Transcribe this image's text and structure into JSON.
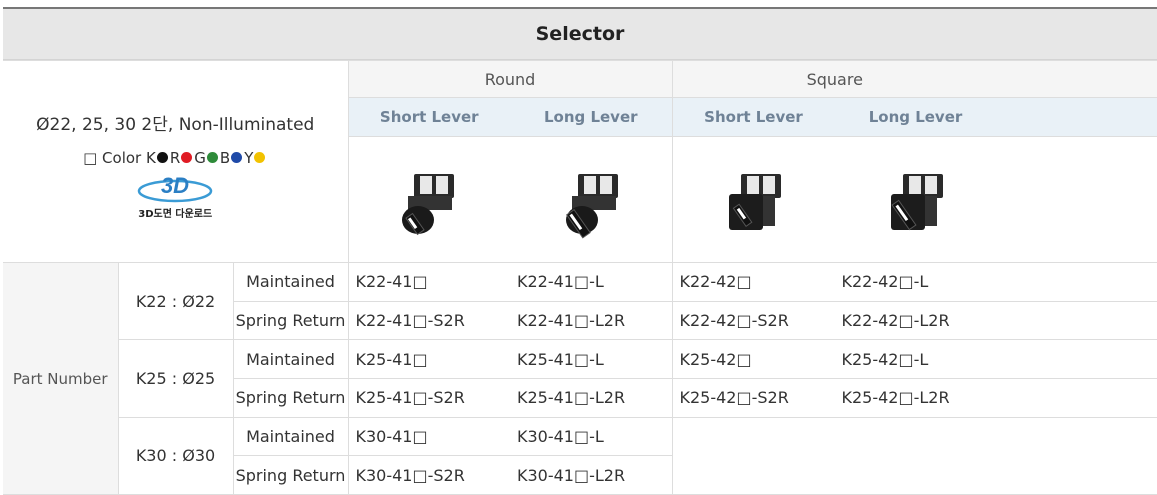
{
  "title": "Selector",
  "info": {
    "spec": "Ø22, 25, 30 2단, Non-Illuminated",
    "color_prefix": "□ Color",
    "colors": [
      {
        "letter": "K",
        "hex": "#111111"
      },
      {
        "letter": "R",
        "hex": "#e01b24"
      },
      {
        "letter": "G",
        "hex": "#2e8b3a"
      },
      {
        "letter": "B",
        "hex": "#1f4aa8"
      },
      {
        "letter": "Y",
        "hex": "#f2c200"
      }
    ],
    "logo_text": "3D",
    "download_label": "3D도면 다운로드"
  },
  "groups": [
    "Round",
    "Square"
  ],
  "sub_headers": [
    "Short Lever",
    "Long Lever",
    "Short Lever",
    "Long Lever"
  ],
  "part_number_label": "Part Number",
  "sizes": [
    {
      "label": "K22 : Ø22",
      "rows": [
        {
          "type": "Maintained",
          "parts": [
            "K22-41□",
            "K22-41□-L",
            "K22-42□",
            "K22-42□-L"
          ]
        },
        {
          "type": "Spring Return",
          "parts": [
            "K22-41□-S2R",
            "K22-41□-L2R",
            "K22-42□-S2R",
            "K22-42□-L2R"
          ]
        }
      ]
    },
    {
      "label": "K25 : Ø25",
      "rows": [
        {
          "type": "Maintained",
          "parts": [
            "K25-41□",
            "K25-41□-L",
            "K25-42□",
            "K25-42□-L"
          ]
        },
        {
          "type": "Spring Return",
          "parts": [
            "K25-41□-S2R",
            "K25-41□-L2R",
            "K25-42□-S2R",
            "K25-42□-L2R"
          ]
        }
      ]
    },
    {
      "label": "K30 : Ø30",
      "rows": [
        {
          "type": "Maintained",
          "parts": [
            "K30-41□",
            "K30-41□-L",
            "",
            ""
          ]
        },
        {
          "type": "Spring Return",
          "parts": [
            "K30-41□-S2R",
            "K30-41□-L2R",
            "",
            ""
          ]
        }
      ]
    }
  ]
}
